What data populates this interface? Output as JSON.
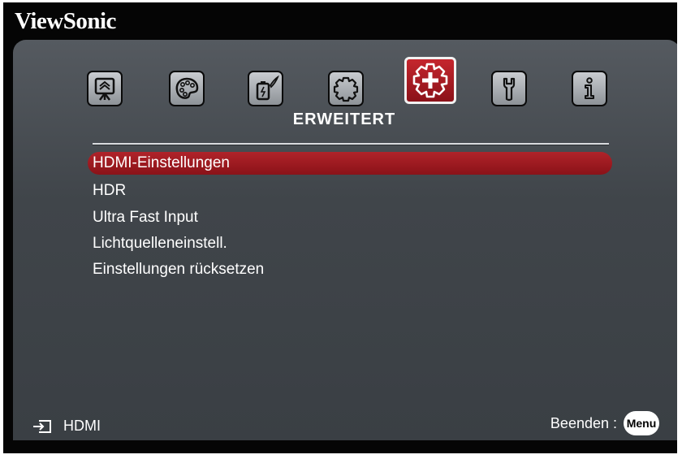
{
  "brand": "ViewSonic",
  "tabs": [
    {
      "icon": "display-icon"
    },
    {
      "icon": "palette-icon"
    },
    {
      "icon": "power-management-icon"
    },
    {
      "icon": "gear-icon"
    },
    {
      "icon": "advanced-gear-plus-icon",
      "active": true
    },
    {
      "icon": "wrench-icon"
    },
    {
      "icon": "info-icon"
    }
  ],
  "section_title": "ERWEITERT",
  "menu_items": [
    {
      "label": "HDMI-Einstellungen",
      "selected": true
    },
    {
      "label": "HDR"
    },
    {
      "label": "Ultra Fast Input"
    },
    {
      "label": "Lichtquelleneinstell."
    },
    {
      "label": "Einstellungen rücksetzen"
    }
  ],
  "footer": {
    "input_source": "HDMI",
    "exit_label": "Beenden :",
    "menu_button": "Menu"
  },
  "colors": {
    "accent": "#9e1a21",
    "panel": "#44494e",
    "background": "#050505"
  }
}
